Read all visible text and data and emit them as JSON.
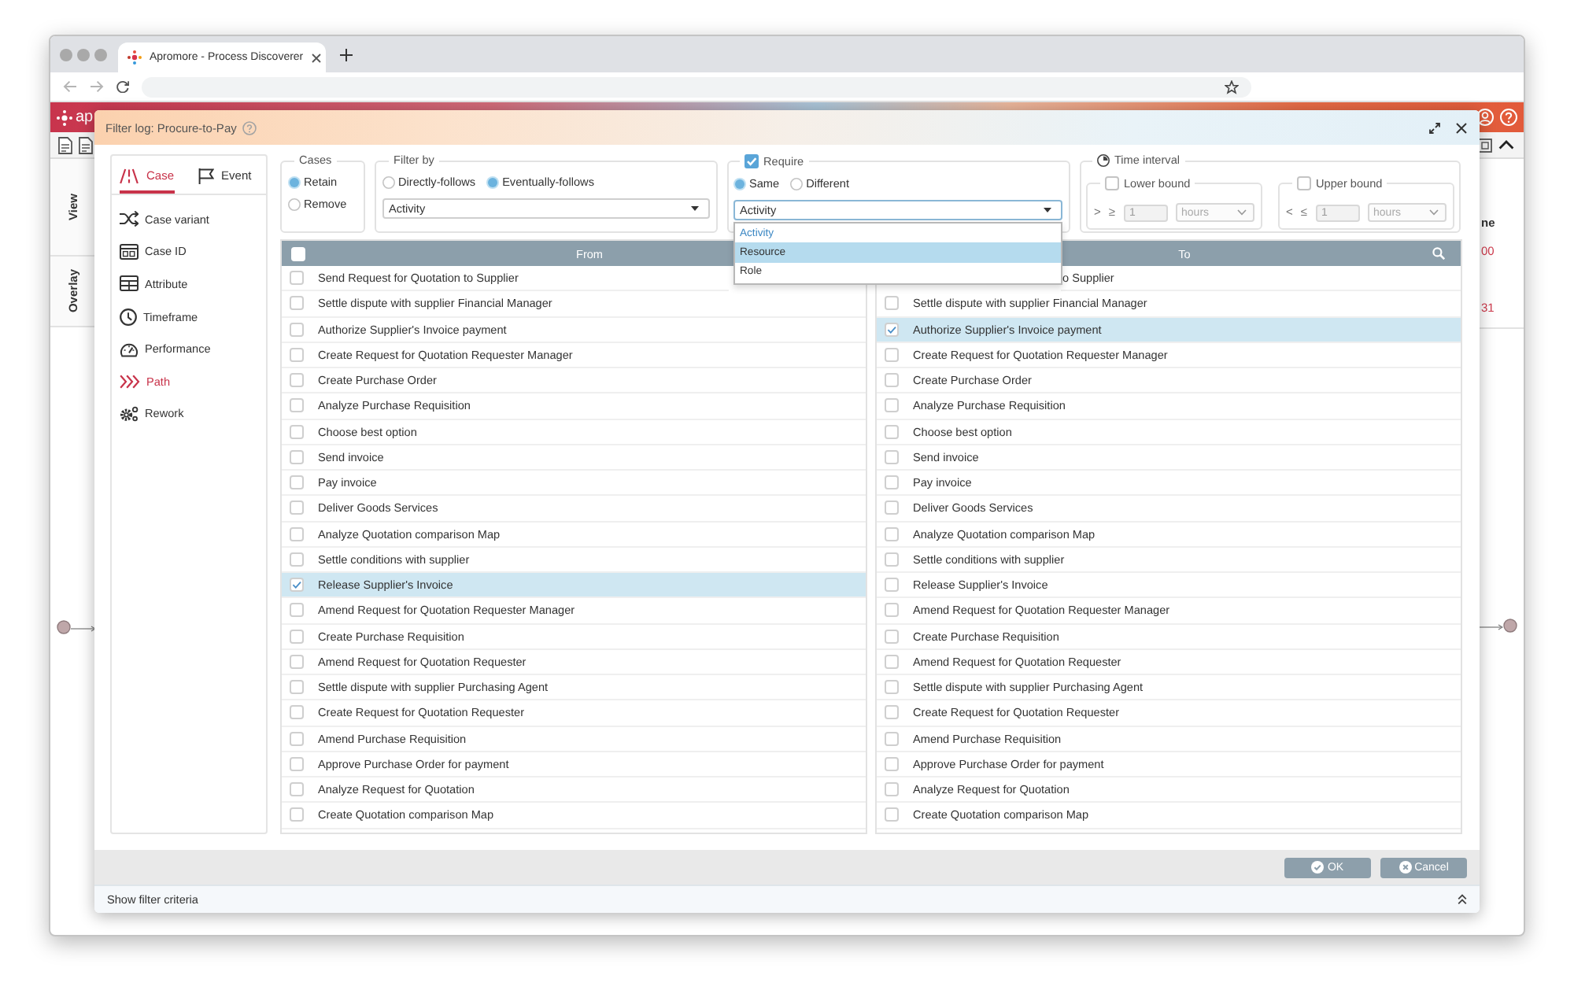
{
  "browser": {
    "tab_title": "Apromore - Process Discoverer"
  },
  "app": {
    "logo_text": "ap",
    "rail": [
      {
        "label": "View"
      },
      {
        "label": "Overlay"
      }
    ],
    "side_texts": [
      {
        "text": "ne",
        "kind": "heading"
      },
      {
        "text": "00",
        "kind": "value"
      },
      {
        "text": "31",
        "kind": "value"
      }
    ]
  },
  "dialog": {
    "title": "Filter log: Procure-to-Pay",
    "sidebar": {
      "tabs": [
        {
          "label": "Case",
          "selected": true
        },
        {
          "label": "Event",
          "selected": false
        }
      ],
      "items": [
        {
          "label": "Case variant",
          "selected": false
        },
        {
          "label": "Case ID",
          "selected": false
        },
        {
          "label": "Attribute",
          "selected": false
        },
        {
          "label": "Timeframe",
          "selected": false
        },
        {
          "label": "Performance",
          "selected": false
        },
        {
          "label": "Path",
          "selected": true
        },
        {
          "label": "Rework",
          "selected": false
        }
      ]
    },
    "cases": {
      "legend": "Cases",
      "options": [
        {
          "label": "Retain",
          "selected": true
        },
        {
          "label": "Remove",
          "selected": false
        }
      ]
    },
    "filter_by": {
      "legend": "Filter by",
      "options": [
        {
          "label": "Directly-follows",
          "selected": false
        },
        {
          "label": "Eventually-follows",
          "selected": true
        }
      ],
      "select": {
        "value": "Activity"
      }
    },
    "require": {
      "legend": "Require",
      "checked": true,
      "options": [
        {
          "label": "Same",
          "selected": true
        },
        {
          "label": "Different",
          "selected": false
        }
      ],
      "select": {
        "value": "Activity",
        "expanded": true,
        "options": [
          {
            "label": "Activity",
            "selected": true,
            "hovered": false
          },
          {
            "label": "Resource",
            "selected": false,
            "hovered": true
          },
          {
            "label": "Role",
            "selected": false,
            "hovered": false
          }
        ]
      }
    },
    "time_interval": {
      "legend": "Time interval",
      "bounds": [
        {
          "label": "Lower bound",
          "checked": false,
          "disabled": true,
          "operators": [
            ">",
            "≥"
          ],
          "value": "1",
          "unit": "hours"
        },
        {
          "label": "Upper bound",
          "checked": false,
          "disabled": true,
          "operators": [
            "<",
            "≤"
          ],
          "value": "1",
          "unit": "hours"
        }
      ]
    },
    "from_table": {
      "header": "From",
      "select_all": {
        "checked": false
      },
      "rows": [
        {
          "label": "Send Request for Quotation to Supplier",
          "selected": false
        },
        {
          "label": "Settle dispute with supplier Financial Manager",
          "selected": false
        },
        {
          "label": "Authorize Supplier's Invoice payment",
          "selected": false
        },
        {
          "label": "Create Request for Quotation Requester Manager",
          "selected": false
        },
        {
          "label": "Create Purchase Order",
          "selected": false
        },
        {
          "label": "Analyze Purchase Requisition",
          "selected": false
        },
        {
          "label": "Choose best option",
          "selected": false
        },
        {
          "label": "Send invoice",
          "selected": false
        },
        {
          "label": "Pay invoice",
          "selected": false
        },
        {
          "label": "Deliver Goods Services",
          "selected": false
        },
        {
          "label": "Analyze Quotation comparison Map",
          "selected": false
        },
        {
          "label": "Settle conditions with supplier",
          "selected": false
        },
        {
          "label": "Release Supplier's Invoice",
          "selected": true
        },
        {
          "label": "Amend Request for Quotation Requester Manager",
          "selected": false
        },
        {
          "label": "Create Purchase Requisition",
          "selected": false
        },
        {
          "label": "Amend Request for Quotation Requester",
          "selected": false
        },
        {
          "label": "Settle dispute with supplier Purchasing Agent",
          "selected": false
        },
        {
          "label": "Create Request for Quotation Requester",
          "selected": false
        },
        {
          "label": "Amend Purchase Requisition",
          "selected": false
        },
        {
          "label": "Approve Purchase Order for payment",
          "selected": false
        },
        {
          "label": "Analyze Request for Quotation",
          "selected": false
        },
        {
          "label": "Create Quotation comparison Map",
          "selected": false
        }
      ]
    },
    "to_table": {
      "header": "To",
      "rows": [
        {
          "label": "o Supplier",
          "selected": false
        },
        {
          "label": "Settle dispute with supplier Financial Manager",
          "selected": false
        },
        {
          "label": "Authorize Supplier's Invoice payment",
          "selected": true
        },
        {
          "label": "Create Request for Quotation Requester Manager",
          "selected": false
        },
        {
          "label": "Create Purchase Order",
          "selected": false
        },
        {
          "label": "Analyze Purchase Requisition",
          "selected": false
        },
        {
          "label": "Choose best option",
          "selected": false
        },
        {
          "label": "Send invoice",
          "selected": false
        },
        {
          "label": "Pay invoice",
          "selected": false
        },
        {
          "label": "Deliver Goods Services",
          "selected": false
        },
        {
          "label": "Analyze Quotation comparison Map",
          "selected": false
        },
        {
          "label": "Settle conditions with supplier",
          "selected": false
        },
        {
          "label": "Release Supplier's Invoice",
          "selected": false
        },
        {
          "label": "Amend Request for Quotation Requester Manager",
          "selected": false
        },
        {
          "label": "Create Purchase Requisition",
          "selected": false
        },
        {
          "label": "Amend Request for Quotation Requester",
          "selected": false
        },
        {
          "label": "Settle dispute with supplier Purchasing Agent",
          "selected": false
        },
        {
          "label": "Create Request for Quotation Requester",
          "selected": false
        },
        {
          "label": "Amend Purchase Requisition",
          "selected": false
        },
        {
          "label": "Approve Purchase Order for payment",
          "selected": false
        },
        {
          "label": "Analyze Request for Quotation",
          "selected": false
        },
        {
          "label": "Create Quotation comparison Map",
          "selected": false
        }
      ]
    },
    "buttons": [
      {
        "label": "OK",
        "kind": "ok"
      },
      {
        "label": "Cancel",
        "kind": "cancel"
      }
    ],
    "criteria_bar": {
      "label": "Show filter criteria"
    }
  }
}
